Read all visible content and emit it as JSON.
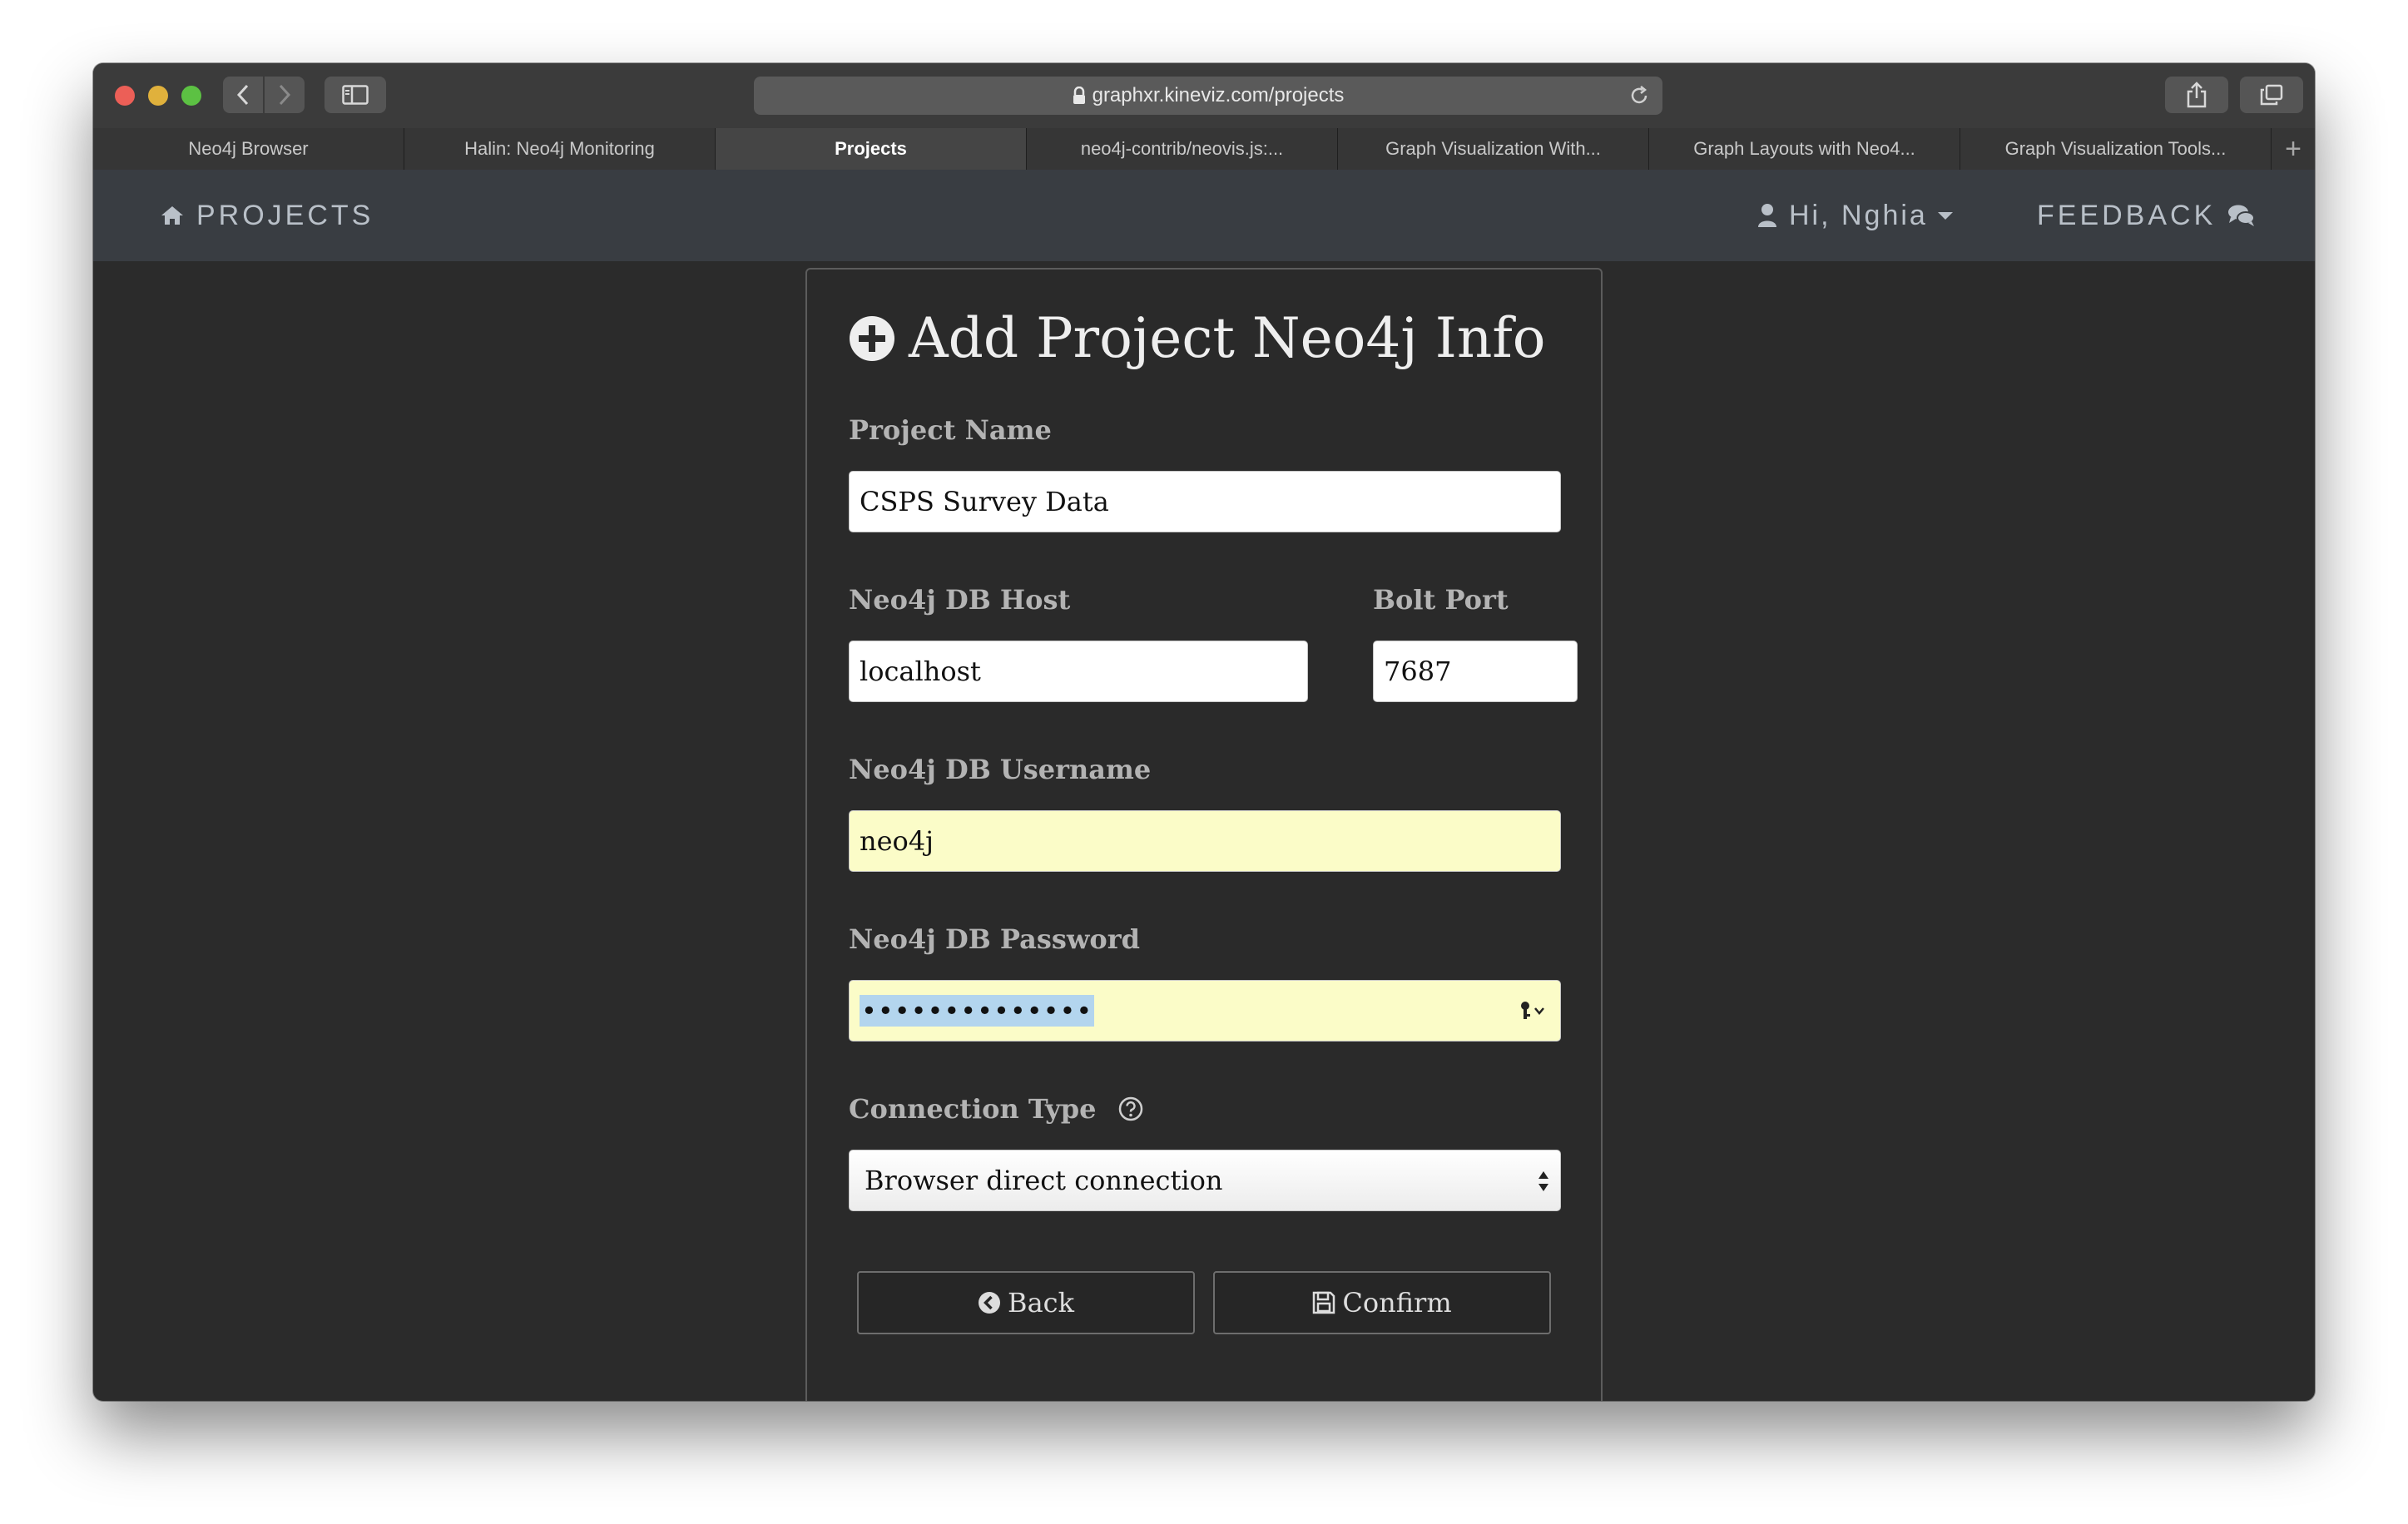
{
  "browser": {
    "url": "graphxr.kineviz.com/projects",
    "tabs": [
      {
        "label": "Neo4j Browser",
        "active": false
      },
      {
        "label": "Halin: Neo4j Monitoring",
        "active": false
      },
      {
        "label": "Projects",
        "active": true
      },
      {
        "label": "neo4j-contrib/neovis.js:...",
        "active": false
      },
      {
        "label": "Graph Visualization With...",
        "active": false
      },
      {
        "label": "Graph Layouts with Neo4...",
        "active": false
      },
      {
        "label": "Graph Visualization Tools...",
        "active": false
      }
    ],
    "new_tab_label": "+"
  },
  "appnav": {
    "brand": "PROJECTS",
    "user_greeting": "Hi, Nghia",
    "feedback": "FEEDBACK"
  },
  "form": {
    "title": "Add Project Neo4j Info",
    "project_name": {
      "label": "Project Name",
      "value": "CSPS Survey Data"
    },
    "host": {
      "label": "Neo4j DB Host",
      "value": "localhost"
    },
    "port": {
      "label": "Bolt Port",
      "value": "7687"
    },
    "username": {
      "label": "Neo4j DB Username",
      "value": "neo4j"
    },
    "password": {
      "label": "Neo4j DB Password",
      "value": "••••••••••••••"
    },
    "connection_type": {
      "label": "Connection Type",
      "value": "Browser direct connection"
    },
    "back_label": "Back",
    "confirm_label": "Confirm"
  },
  "colors": {
    "app_background": "#2b2b2b",
    "navbar": "#393d42",
    "autofill": "#fbfcc8"
  }
}
